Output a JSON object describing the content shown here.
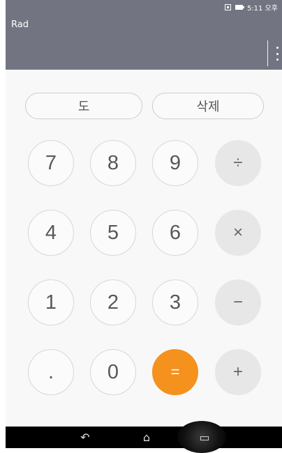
{
  "status_bar": {
    "time": "5:11 오후"
  },
  "header": {
    "mode": "Rad",
    "menu_icon": "more-vert-icon"
  },
  "function_row": {
    "degree_label": "도",
    "delete_label": "삭제"
  },
  "keys": {
    "row1": [
      "7",
      "8",
      "9",
      "÷"
    ],
    "row2": [
      "4",
      "5",
      "6",
      "×"
    ],
    "row3": [
      "1",
      "2",
      "3",
      "−"
    ],
    "row4": [
      ".",
      "0",
      "=",
      "+"
    ]
  },
  "colors": {
    "accent": "#f5911d",
    "header": "#727581",
    "operator_bg": "#e7e7e7"
  },
  "nav": {
    "back_icon": "back-icon",
    "home_icon": "home-icon",
    "recents_icon": "recents-icon"
  }
}
